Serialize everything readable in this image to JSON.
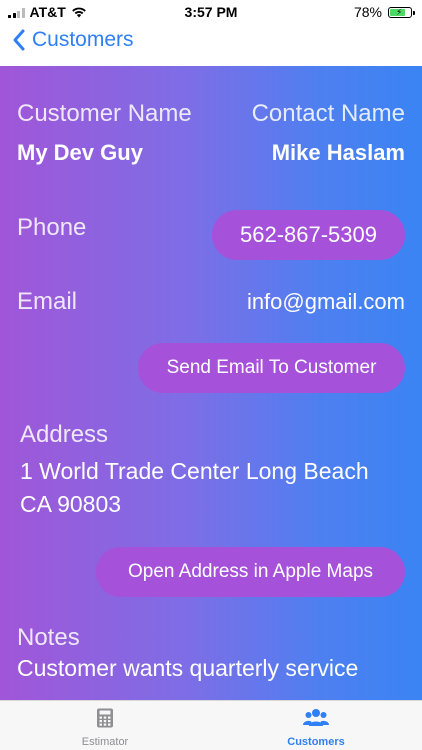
{
  "status_bar": {
    "carrier": "AT&T",
    "time": "3:57 PM",
    "battery_percent": "78%",
    "battery_level": 0.78,
    "battery_color": "#4cd964"
  },
  "nav": {
    "back_label": "Customers",
    "accent_color": "#2f7ff7"
  },
  "customer": {
    "customer_name_label": "Customer Name",
    "customer_name": "My Dev Guy",
    "contact_name_label": "Contact Name",
    "contact_name": "Mike Haslam",
    "phone_label": "Phone",
    "phone": "562-867-5309",
    "email_label": "Email",
    "email": "info@gmail.com",
    "send_email_label": "Send Email To Customer",
    "address_label": "Address",
    "address_line1": "1 World Trade Center Long Beach",
    "address_line2": "CA 90803",
    "open_maps_label": "Open Address in Apple Maps",
    "notes_label": "Notes",
    "notes": "Customer wants quarterly service"
  },
  "tab_bar": {
    "tabs": [
      {
        "label": "Estimator",
        "icon": "calculator-icon",
        "selected": false
      },
      {
        "label": "Customers",
        "icon": "people-icon",
        "selected": true
      }
    ]
  }
}
